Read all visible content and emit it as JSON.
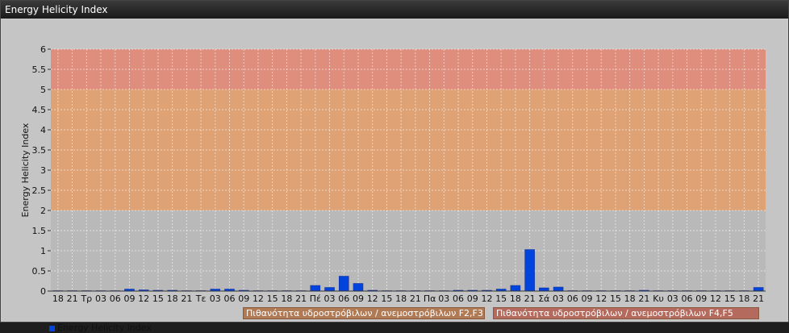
{
  "window": {
    "title": "Energy Helicity Index"
  },
  "chart_data": {
    "type": "bar",
    "ylabel": "Energy Helicity Index",
    "ylim": [
      0,
      6
    ],
    "yticks": [
      0,
      0.5,
      1,
      1.5,
      2,
      2.5,
      3,
      3.5,
      4,
      4.5,
      5,
      5.5,
      6
    ],
    "categories": [
      "18",
      "21",
      "Τρ",
      "03",
      "06",
      "09",
      "12",
      "15",
      "18",
      "21",
      "Τε",
      "03",
      "06",
      "09",
      "12",
      "15",
      "18",
      "21",
      "Πέ",
      "03",
      "06",
      "09",
      "12",
      "15",
      "18",
      "21",
      "Πα",
      "03",
      "06",
      "09",
      "12",
      "15",
      "18",
      "21",
      "Σά",
      "03",
      "06",
      "09",
      "12",
      "15",
      "18",
      "21",
      "Κυ",
      "03",
      "06",
      "09",
      "12",
      "15",
      "18",
      "21"
    ],
    "series": [
      {
        "name": "Energy Helicity Index",
        "color": "#0044dd",
        "values": [
          0.01,
          0.01,
          0.01,
          0.01,
          0.01,
          0.05,
          0.03,
          0.02,
          0.02,
          0.01,
          0.01,
          0.05,
          0.05,
          0.02,
          0.01,
          0.01,
          0.01,
          0.01,
          0.14,
          0.09,
          0.37,
          0.19,
          0.02,
          0.01,
          0.01,
          0.01,
          0.01,
          0.01,
          0.02,
          0.02,
          0.02,
          0.05,
          0.14,
          1.03,
          0.08,
          0.1,
          0.01,
          0.01,
          0.01,
          0.01,
          0.01,
          0.02,
          0.01,
          0.01,
          0.01,
          0.01,
          0.01,
          0.01,
          0.01,
          0.09
        ]
      }
    ],
    "zones": [
      {
        "from": 2,
        "to": 5,
        "color": "#e0a070",
        "label": "Πιθανότητα υδροστρόβιλων / ανεμοστρόβιλων F2,F3"
      },
      {
        "from": 5,
        "to": 6,
        "color": "#e08a78",
        "label": "Πιθανότητα υδροστρόβιλων / ανεμοστρόβιλων F4,F5"
      }
    ],
    "grid": true,
    "legend": "bottom-left"
  }
}
